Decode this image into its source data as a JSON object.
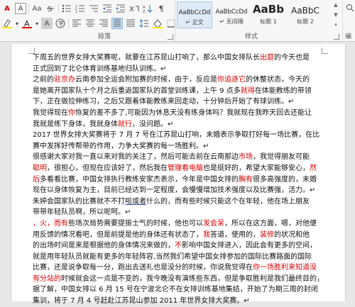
{
  "ribbon": {
    "paragraph_label": "段落",
    "styles_label": "样式",
    "edit_label": "编",
    "styles": [
      {
        "preview": "AaBbCcDd",
        "name": "↵ 正文"
      },
      {
        "preview": "AaBbCcDd",
        "name": "↵ 无间隔"
      },
      {
        "preview": "AaBb",
        "name": "标题 1"
      },
      {
        "preview": "AaBbC",
        "name": "标题 2"
      }
    ],
    "scroll_up": "▲",
    "scroll_down": "▼",
    "more": "▾",
    "toolbar_glyphs": {
      "font_color_a": "A",
      "char_border": "A",
      "aa": "Aa",
      "highlight_a": "A",
      "char_a": "A",
      "wen": "wén",
      "dropdown": "▾"
    }
  },
  "document": {
    "lines": [
      [
        {
          "t": "    下周五的世界女排大奖赛呢，就要在江苏昆山打响了，那么中国女排队长"
        },
        {
          "t": "出庭",
          "c": "r"
        },
        {
          "t": "的今天也是"
        }
      ],
      [
        {
          "t": "正式回到了北仑体育训练基地归队训练。↵"
        }
      ],
      [
        {
          "t": "    之前的"
        },
        {
          "t": "驻京办",
          "c": "r"
        },
        {
          "t": "云南参加全运会附加赛的时候，由于，反应是"
        },
        {
          "t": "你追逐它",
          "c": "r"
        },
        {
          "t": "的休整状态，今天的"
        }
      ],
      [
        {
          "t": "是她离开国家队十个月之后重返国家队的首堂训练课，上午 9 点多"
        },
        {
          "t": "就得",
          "c": "r"
        },
        {
          "t": "在体能教练的带领"
        }
      ],
      [
        {
          "t": "下，正在做拉伸练习，之后又跟着体能教练来回走动，十分钟后开始了有球训练。↵"
        }
      ],
      [
        {
          "t": "我觉得现在"
        },
        {
          "t": "你",
          "c": "r"
        },
        {
          "t": "恢复的差不多了,可能因为休息天没有练身体吗？我就现在我昨天回去还能让"
        }
      ],
      [
        {
          "t": "我就是练下身体，我就身体"
        },
        {
          "t": "就行",
          "c": "r"
        },
        {
          "t": "，没问题。↵"
        }
      ],
      [
        {
          "t": "2017 世界女排大奖赛将于 7 月 7 号在江苏昆山打响，未婚表示争取打好每一场比赛，在比"
        }
      ],
      [
        {
          "t": "赛中发挥好传帮带的作用，力争大奖赛的每一场胜利。↵"
        }
      ],
      [
        {
          "t": "    很感谢大家对我一直以来对我的关注了，然后可能去前在云南那边"
        },
        {
          "t": "市场",
          "c": "r"
        },
        {
          "t": "，我觉得朋友可能"
        }
      ],
      [
        {
          "t": "聪明",
          "c": "r"
        },
        {
          "t": "，很担心，但现在应该好了，然后我在"
        },
        {
          "t": "管理看电脑",
          "c": "r"
        },
        {
          "t": "也是挺好的，希望大家能够安心，"
        },
        {
          "t": "然",
          "c": "r"
        }
      ],
      [
        {
          "t": "后",
          "c": "r"
        },
        {
          "t": "多看看比赛，中国女排执行教练安家杰表示，今年是中国女排的"
        },
        {
          "t": "胸有",
          "c": "r"
        },
        {
          "t": "很多高强度的，未婚"
        }
      ],
      [
        {
          "t": "现在以身体恢复为主，目前已经达到一定程度，会慢慢增加技术强度以及比赛强，活力。↵"
        }
      ],
      [
        {
          "t": "    朱婷会国家队的比赛就不不打"
        },
        {
          "t": "啦或者",
          "c": "ul"
        },
        {
          "t": "什么的，而有些时候只能这个在年轻，他在场上朋友"
        }
      ],
      [
        {
          "t": "带带年轻队员啊，所以呢呵。↵"
        }
      ],
      [
        {
          "t": "，火，而有",
          "c": "r"
        },
        {
          "t": "些场次局势需要提振士气的时候，他也可以"
        },
        {
          "t": "发会呆",
          "c": "r"
        },
        {
          "t": "，所以在这方面，嗯，对他便"
        }
      ],
      [
        {
          "t": "用反馈的情况看吧，但是前提是他的身体还有状态了，"
        },
        {
          "t": "我",
          "c": "r"
        },
        {
          "t": "答道，使用的，"
        },
        {
          "t": "装修",
          "c": "r"
        },
        {
          "t": "的状况和他"
        }
      ],
      [
        {
          "t": "的出场时间是来是根据他的身体情况来做的，"
        },
        {
          "t": "不",
          "c": "r"
        },
        {
          "t": "影响中国女排进入，因此会有更多的空间，"
        }
      ],
      [
        {
          "t": "就是用年轻队员就能有更多的年轻阵容,当然我们希望中国女排参加的国际比赛路面的国际"
        }
      ],
      [
        {
          "t": "比赛，还是说争取每一分，跑出去送礼也是没分的时候，你说我觉得在"
        },
        {
          "t": "你一场胜利来知道没",
          "c": "r"
        }
      ],
      [
        {
          "t": "有分站的",
          "c": "r"
        },
        {
          "t": "时候就会这一点是不变的，我今晚没有演练些东西，但是争取胜利是我们最终目的，"
        }
      ],
      [
        {
          "t": "据了解，中国女排以 6 月 15 号在宁波北仑不在女排训练基地集结，开始了为期三周的封闭"
        }
      ],
      [
        {
          "t": "集训，将于 7 月 4 号赶赴江苏昆山参加 2011 年世界女排大奖赛。↵"
        }
      ]
    ]
  }
}
